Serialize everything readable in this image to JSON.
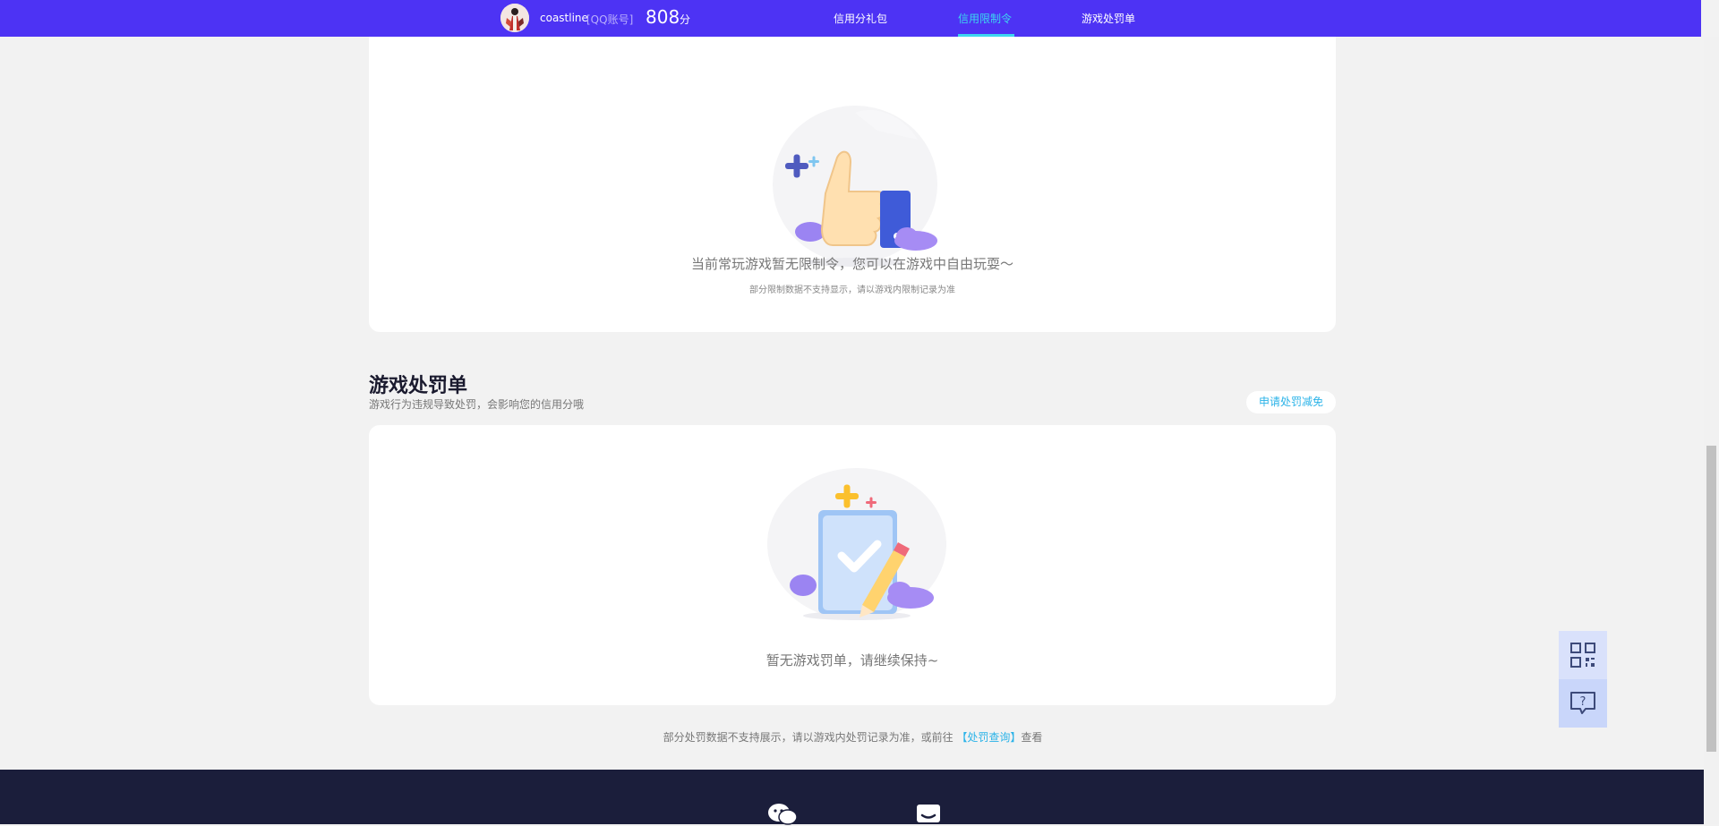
{
  "header": {
    "username": "coastline",
    "account_type": "[QQ账号]",
    "score": "808",
    "score_unit": "分",
    "tabs": [
      {
        "label": "信用分礼包",
        "active": false
      },
      {
        "label": "信用限制令",
        "active": true
      },
      {
        "label": "游戏处罚单",
        "active": false
      }
    ]
  },
  "restriction_card": {
    "empty_message": "当前常玩游戏暂无限制令，您可以在游戏中自由玩耍～",
    "note": "部分限制数据不支持显示，请以游戏内限制记录为准"
  },
  "penalty_section": {
    "title": "游戏处罚单",
    "subtitle": "游戏行为违规导致处罚，会影响您的信用分哦",
    "appeal_button": "申请处罚减免",
    "empty_message": "暂无游戏罚单，请继续保持~"
  },
  "footnote": {
    "text_before": "部分处罚数据不支持展示，请以游戏内处罚记录为准，或前往",
    "link": "【处罚查询】",
    "text_after": "查看"
  },
  "floating": {
    "qrcode_icon": "qrcode-icon",
    "feedback_icon": "question-chat-icon"
  },
  "footer": {
    "icons": [
      "wechat-icon",
      "chat-bubble-icon"
    ]
  },
  "colors": {
    "header_bg": "#4d33f4",
    "active_tab": "#3cd6f0",
    "link": "#2bb3e8",
    "footer_bg": "#1b1e3b",
    "page_bg": "#f2f2f2"
  }
}
